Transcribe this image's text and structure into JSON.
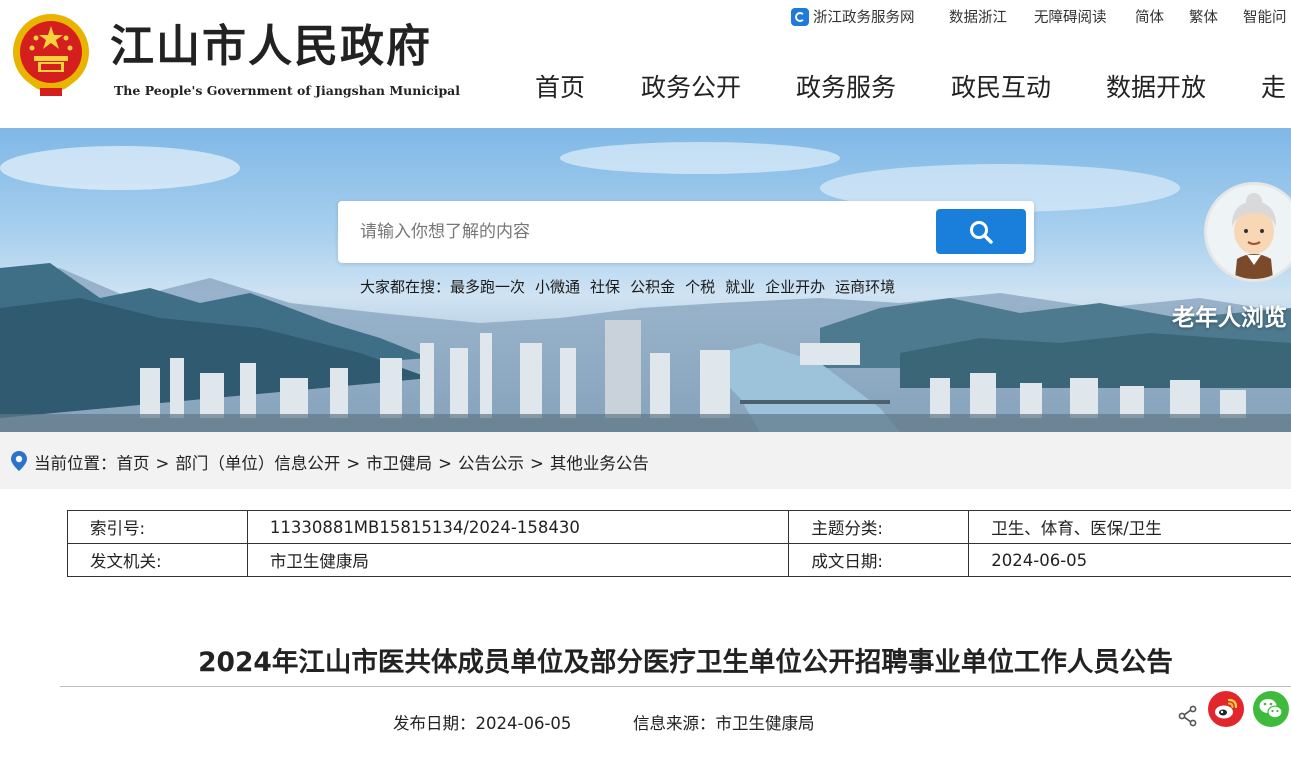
{
  "header": {
    "title": "江山市人民政府",
    "subtitle": "The People's Government of Jiangshan Municipal",
    "top_links": [
      "浙江政务服务网",
      "数据浙江",
      "无障碍阅读",
      "简体",
      "繁体",
      "智能问"
    ],
    "nav": [
      "首页",
      "政务公开",
      "政务服务",
      "政民互动",
      "数据开放",
      "走"
    ]
  },
  "search": {
    "placeholder": "请输入你想了解的内容",
    "hot_label": "大家都在搜：",
    "hot_keywords": [
      "最多跑一次",
      "小微通",
      "社保",
      "公积金",
      "个税",
      "就业",
      "企业开办",
      "运商环境"
    ]
  },
  "elder": {
    "label": "老年人浏览"
  },
  "breadcrumb": {
    "label": "当前位置：",
    "items": [
      "首页",
      "部门（单位）信息公开",
      "市卫健局",
      "公告公示",
      "其他业务公告"
    ],
    "separator": ">"
  },
  "info": {
    "index_label": "索引号:",
    "index_value": "11330881MB15815134/2024-158430",
    "topic_label": "主题分类:",
    "topic_value": "卫生、体育、医保/卫生",
    "issuer_label": "发文机关:",
    "issuer_value": "市卫生健康局",
    "date_label": "成文日期:",
    "date_value": "2024-06-05"
  },
  "article": {
    "title": "2024年江山市医共体成员单位及部分医疗卫生单位公开招聘事业单位工作人员公告",
    "publish_date": "发布日期：2024-06-05",
    "source": "信息来源：市卫生健康局"
  },
  "colors": {
    "accent": "#1a7fdb",
    "weibo": "#e2262b",
    "wechat": "#3fbb3c",
    "emblem_red": "#d51f1f",
    "gold": "#f2c200"
  }
}
